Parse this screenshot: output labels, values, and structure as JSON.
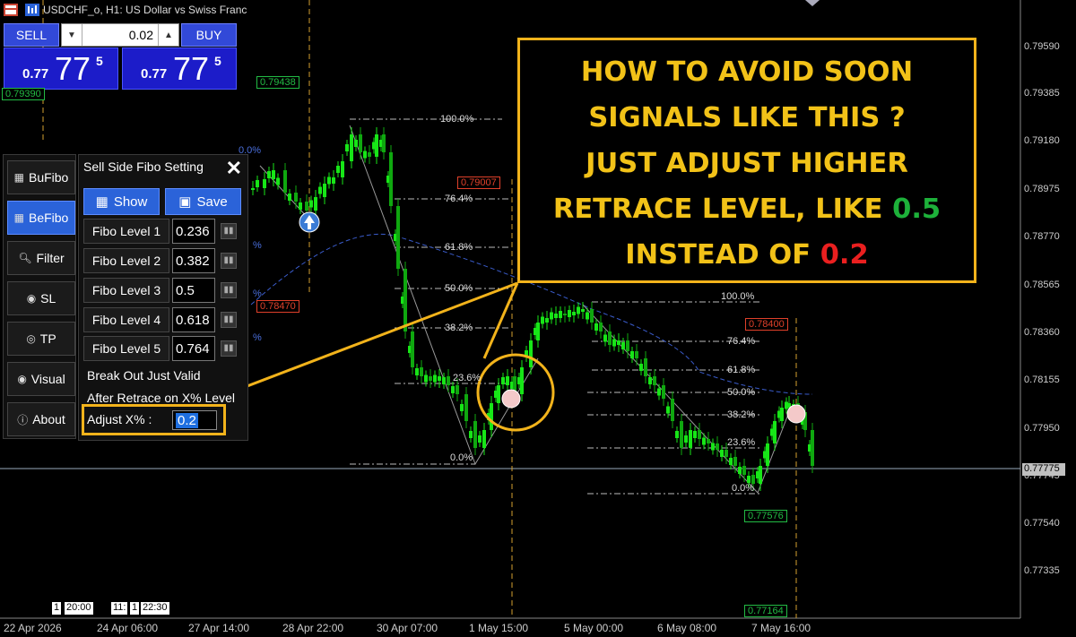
{
  "window": {
    "title": "USDCHF_o, H1:  US Dollar vs Swiss Franc"
  },
  "trade_panel": {
    "sell_label": "SELL",
    "buy_label": "BUY",
    "lot_value": "0.02",
    "sell_price_prefix": "0.77",
    "sell_price_big": "77",
    "sell_price_sup": "5",
    "buy_price_prefix": "0.77",
    "buy_price_big": "77",
    "buy_price_sup": "5"
  },
  "tool_panel": {
    "items": [
      {
        "label": "BuFibo",
        "icon": "chart-icon",
        "active": false
      },
      {
        "label": "BeFibo",
        "icon": "chart-icon",
        "active": true
      },
      {
        "label": "Filter",
        "icon": "search-icon",
        "active": false
      },
      {
        "label": "SL",
        "icon": "record-icon",
        "active": false
      },
      {
        "label": "TP",
        "icon": "target-icon",
        "active": false
      },
      {
        "label": "Visual",
        "icon": "eye-icon",
        "active": false
      },
      {
        "label": "About",
        "icon": "info-icon",
        "active": false
      }
    ]
  },
  "fibo_panel": {
    "title": "Sell Side Fibo Setting",
    "close_symbol": "✕",
    "show_label": "Show",
    "save_label": "Save",
    "levels": [
      {
        "label": "Fibo Level 1",
        "value": "0.236"
      },
      {
        "label": "Fibo Level 2",
        "value": "0.382"
      },
      {
        "label": "Fibo Level 3",
        "value": "0.5"
      },
      {
        "label": "Fibo Level 4",
        "value": "0.618"
      },
      {
        "label": "Fibo Level 5",
        "value": "0.764"
      }
    ],
    "info_line1": "Break Out Just Valid",
    "info_line2": "After Retrace on X% Level",
    "adjust_label": "Adjust X% :",
    "adjust_value": "0.2"
  },
  "callout": {
    "line1": "HOW TO AVOID SOON",
    "line2": "SIGNALS LIKE THIS ?",
    "line3": "JUST ADJUST HIGHER",
    "line4_pre": "RETRACE LEVEL, LIKE ",
    "line4_value": "0.5",
    "line5_pre": "INSTEAD OF ",
    "line5_value": "0.2",
    "accent_color": "#f2b31b",
    "good_color": "#1db13a",
    "bad_color": "#ea1f1f"
  },
  "price_axis": {
    "labels": [
      "0.79590",
      "0.79385",
      "0.79180",
      "0.78975",
      "0.78770",
      "0.78565",
      "0.78360",
      "0.78155",
      "0.77950",
      "0.77745",
      "0.77540",
      "0.77335"
    ],
    "current": "0.77775"
  },
  "time_axis": {
    "labels": [
      "22 Apr 2026",
      "24 Apr 06:00",
      "27 Apr 14:00",
      "28 Apr 22:00",
      "30 Apr 07:00",
      "1 May 15:00",
      "5 May 00:00",
      "6 May 08:00",
      "7 May 16:00"
    ]
  },
  "chart_tags": {
    "t1": "0.79390",
    "t2": "0.79438",
    "t3": "0.78470",
    "t4": "0.79007",
    "t5": "0.78400",
    "t6": "0.77576",
    "t7": "0.77164"
  },
  "fib_set_a": {
    "levels": [
      "100.0%",
      "76.4%",
      "61.8%",
      "50.0%",
      "38.2%",
      "23.6%",
      "0.0%"
    ]
  },
  "fib_set_b": {
    "levels": [
      "100.0%",
      "76.4%",
      "61.8%",
      "50.0%",
      "38.2%",
      "23.6%",
      "0.0%"
    ]
  },
  "fib_left_partial": [
    "0.0%",
    "%",
    "%",
    "%"
  ],
  "clocks": {
    "c1": "1",
    "c2": "20:00",
    "c3": "11:",
    "c4": "1",
    "c5": "22:30"
  },
  "colors": {
    "candle": "#17e617",
    "bear_candle": "#0fa80f",
    "ma_line": "#3a5ccc",
    "guide_line": "#d4a030",
    "current_price": "#9ab"
  }
}
